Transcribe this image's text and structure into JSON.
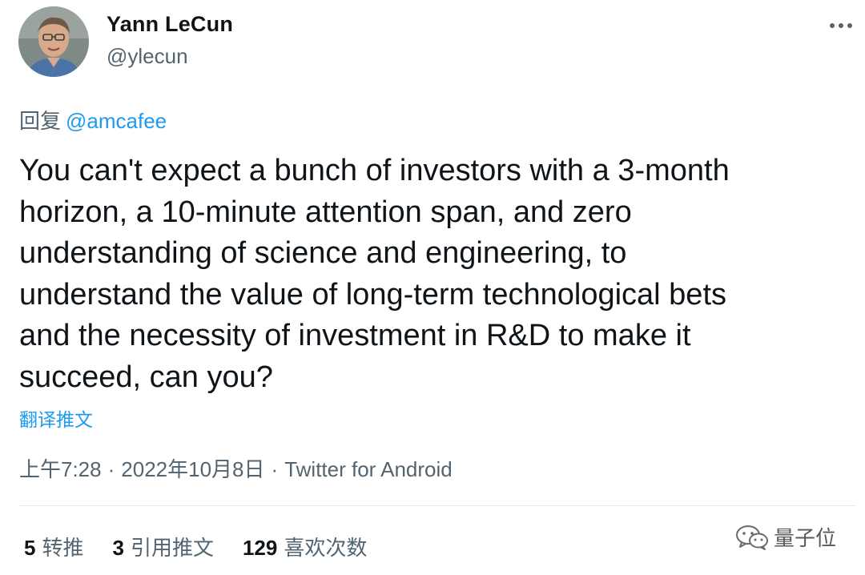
{
  "author": {
    "display_name": "Yann LeCun",
    "handle": "@ylecun"
  },
  "reply": {
    "prefix": "回复",
    "mention": "@amcafee"
  },
  "tweet": {
    "text": "You can't expect a bunch of investors with a 3-month\nhorizon, a 10-minute attention span, and zero\nunderstanding of science and engineering,  to\nunderstand the value of long-term technological bets\nand the necessity of investment in R&D to make it\nsucceed, can you?"
  },
  "translate_label": "翻译推文",
  "meta": {
    "time": "上午7:28",
    "separator": "·",
    "date": "2022年10月8日",
    "source": "Twitter for Android"
  },
  "stats": {
    "retweets": {
      "count": "5",
      "label": "转推"
    },
    "quotes": {
      "count": "3",
      "label": "引用推文"
    },
    "likes": {
      "count": "129",
      "label": "喜欢次数"
    }
  },
  "watermark": {
    "icon": "wechat-icon",
    "text": "量子位"
  },
  "icons": {
    "more": "more-horizontal-icon",
    "avatar": "avatar-photo"
  },
  "colors": {
    "link": "#1d9bf0",
    "secondary_text": "#536471",
    "primary_text": "#0f1419"
  }
}
